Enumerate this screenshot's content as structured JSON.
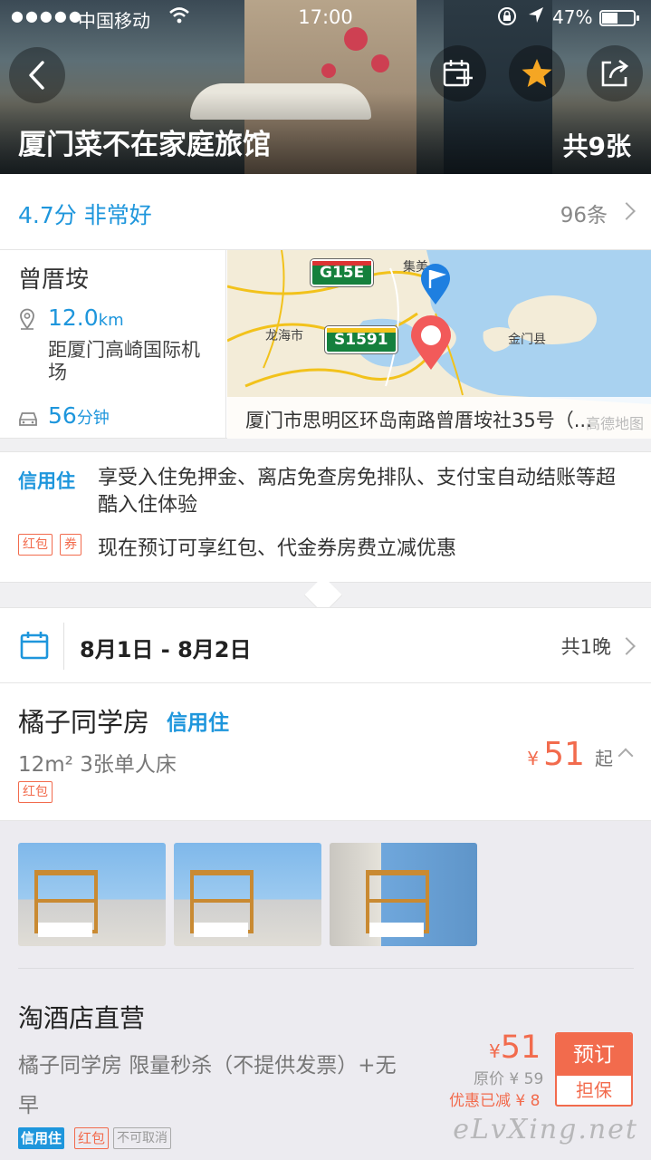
{
  "status_bar": {
    "signal": "●●●●●",
    "carrier": "中国移动",
    "time": "17:00",
    "battery": "47%"
  },
  "hero": {
    "hotel_name": "厦门菜不在家庭旅馆",
    "photo_count": "共9张"
  },
  "rating": {
    "score_text": "4.7分 非常好",
    "review_count": "96条"
  },
  "location": {
    "area": "曾厝垵",
    "distance_value": "12.0",
    "distance_unit": "km",
    "distance_desc": "距厦门高崎国际机场",
    "drive_value": "56",
    "drive_unit": "分钟",
    "map": {
      "address": "厦门市思明区环岛南路曾厝垵社35号（...",
      "credit": "高德地图",
      "labels": [
        "集美",
        "龙海市",
        "金门县"
      ],
      "highways": [
        "G15E",
        "S1591"
      ]
    }
  },
  "credit_stay": {
    "tag": "信用住",
    "text": "享受入住免押金、离店免查房免排队、支付宝自动结账等超酷入住体验",
    "promo_tags": [
      "红包",
      "券"
    ],
    "promo_text": "现在预订可享红包、代金券房费立减优惠"
  },
  "dates": {
    "range": "8月1日 - 8月2日",
    "nights": "共1晚"
  },
  "room": {
    "name": "橘子同学房",
    "credit_tag": "信用住",
    "info": "12m²  3张单人床",
    "tag": "红包",
    "price_currency": "¥",
    "price": "51",
    "price_suffix": "起"
  },
  "offer": {
    "vendor": "淘酒店直营",
    "description": "橘子同学房  限量秒杀（不提供发票）+无早",
    "price_currency": "¥",
    "price": "51",
    "original_price": "原价 ¥ 59",
    "saved": "优惠已减 ¥ 8",
    "book_label": "预订",
    "guarantee_label": "担保",
    "badges": [
      "信用住",
      "红包",
      "不可取消"
    ]
  },
  "watermark": "eLvXing.net",
  "colors": {
    "accent_blue": "#1e96dc",
    "price_orange": "#f26b4d"
  }
}
